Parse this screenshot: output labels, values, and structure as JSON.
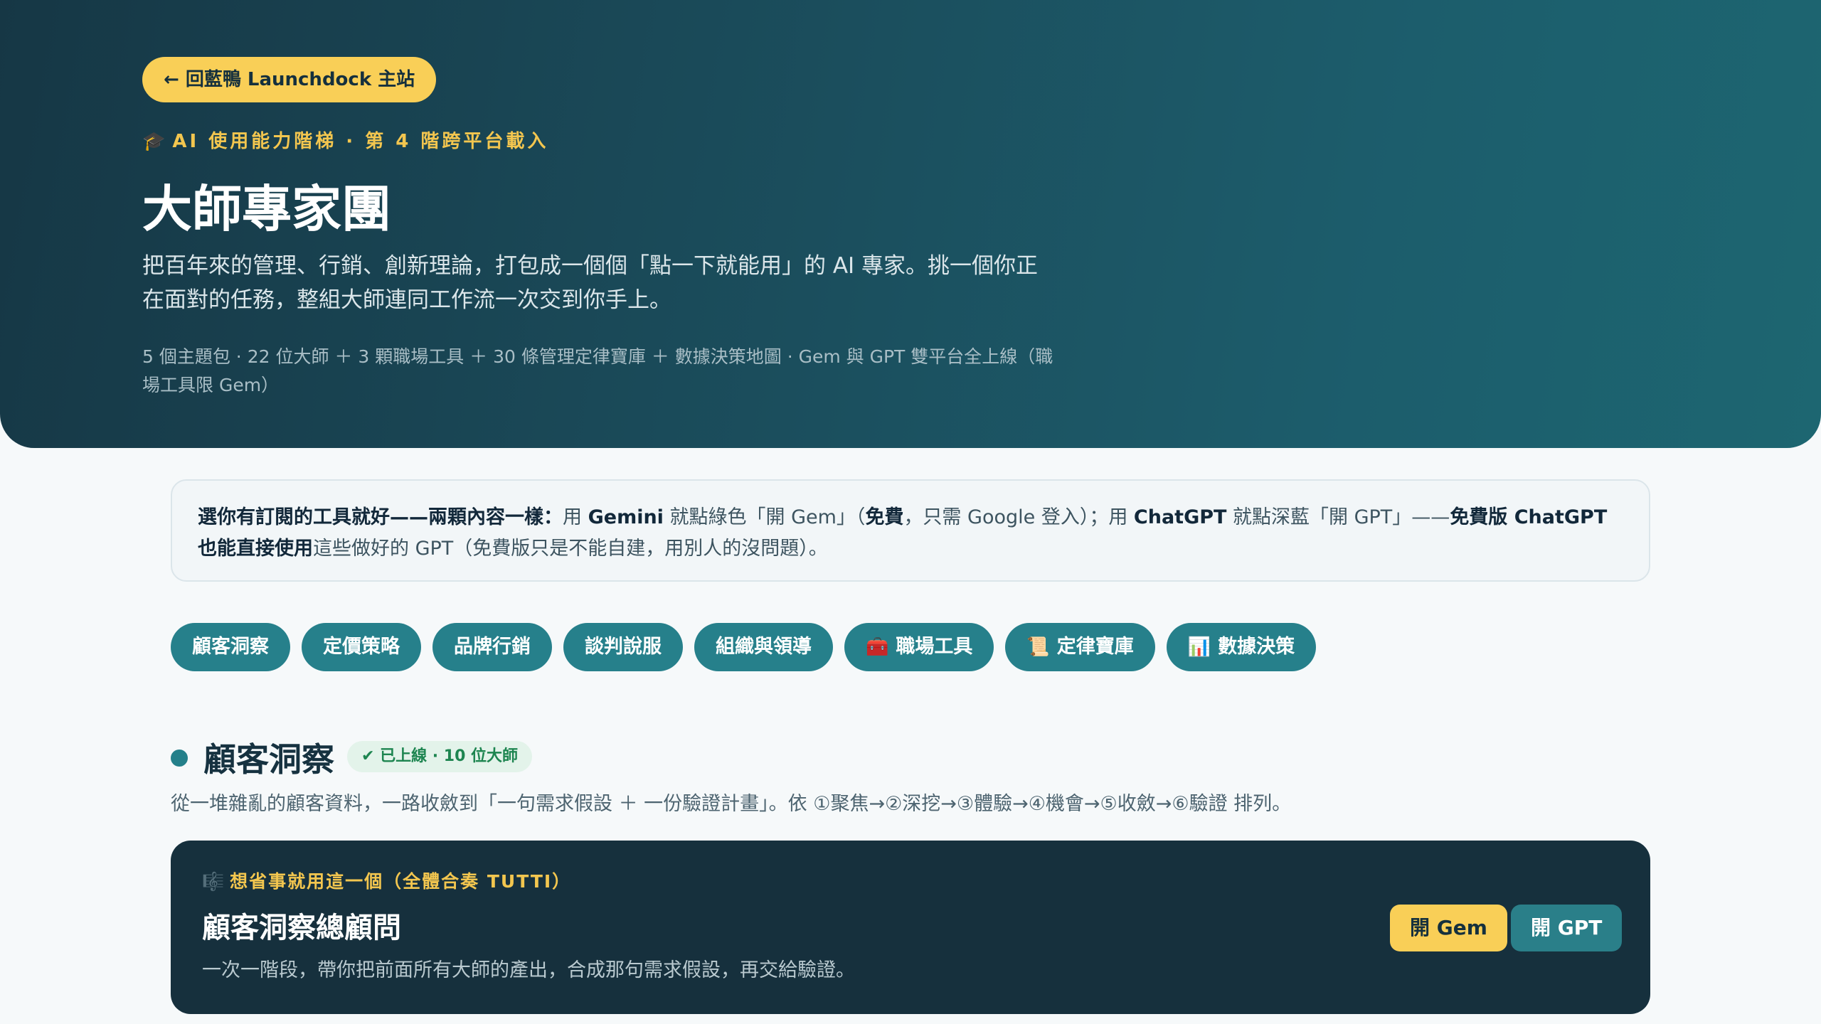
{
  "header": {
    "back_label": "← 回藍鴨 Launchdock 主站",
    "eyebrow_icon": "🎓",
    "eyebrow_text": "AI 使用能力階梯 · 第 4 階跨平台載入",
    "title": "大師專家團",
    "description": "把百年來的管理、行銷、創新理論，打包成一個個「點一下就能用」的 AI 專家。挑一個你正在面對的任務，整組大師連同工作流一次交到你手上。",
    "meta": "5 個主題包 · 22 位大師 ＋ 3 顆職場工具 ＋ 30 條管理定律寶庫 ＋ 數據決策地圖 · Gem 與 GPT 雙平台全上線（職場工具限 Gem）"
  },
  "notice": {
    "p1": "選你有訂閱的工具就好——兩顆內容一樣：",
    "p2": "用 ",
    "p3": "Gemini",
    "p4": " 就點綠色「開 Gem」（",
    "p5": "免費",
    "p6": "，只需 Google 登入）；用 ",
    "p7": "ChatGPT",
    "p8": " 就點深藍「開 GPT」——",
    "p9": "免費版 ChatGPT 也能直接使用",
    "p10": "這些做好的 GPT（免費版只是不能自建，用別人的沒問題）。"
  },
  "tabs": [
    {
      "icon": "",
      "label": "顧客洞察"
    },
    {
      "icon": "",
      "label": "定價策略"
    },
    {
      "icon": "",
      "label": "品牌行銷"
    },
    {
      "icon": "",
      "label": "談判說服"
    },
    {
      "icon": "",
      "label": "組織與領導"
    },
    {
      "icon": "🧰",
      "label": "職場工具"
    },
    {
      "icon": "📜",
      "label": "定律寶庫"
    },
    {
      "icon": "📊",
      "label": "數據決策"
    }
  ],
  "section": {
    "title": "顧客洞察",
    "badge": "✔ 已上線 · 10 位大師",
    "description": "從一堆雜亂的顧客資料，一路收斂到「一句需求假設 ＋ 一份驗證計畫」。依 ①聚焦→②深挖→③體驗→④機會→⑤收斂→⑥驗證 排列。"
  },
  "card": {
    "eyebrow_icon": "🎼",
    "eyebrow_text": "想省事就用這一個（全體合奏 TUTTI）",
    "title": "顧客洞察總顧問",
    "description": "一次一階段，帶你把前面所有大師的產出，合成那句需求假設，再交給驗證。",
    "gem_label": "開 Gem",
    "gpt_label": "開 GPT"
  },
  "colors": {
    "accent_yellow": "#f9cf57",
    "teal": "#26808b",
    "hero_dark": "#163745",
    "card_dark": "#16303d",
    "live_green": "#1d8550"
  }
}
